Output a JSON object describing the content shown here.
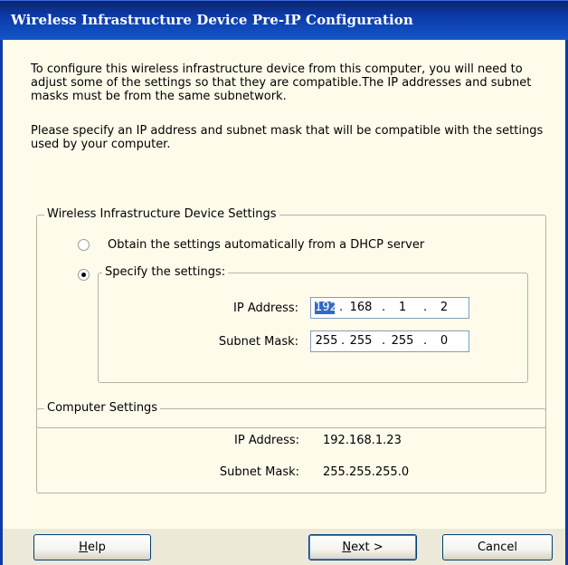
{
  "window": {
    "title": "Wireless Infrastructure Device Pre-IP Configuration"
  },
  "intro": {
    "paragraph1": "To configure this wireless infrastructure device from this computer, you will need to adjust some of the settings so that they are compatible.The IP addresses and subnet masks must be from the same subnetwork.",
    "paragraph2": "Please specify an IP address and subnet mask that will be compatible with the settings used by your computer."
  },
  "device_settings": {
    "legend": "Wireless Infrastructure Device Settings",
    "dhcp_option": "Obtain the settings automatically from a DHCP server",
    "specify_option": "Specify the settings:",
    "selected_option": "specify",
    "ip_label": "IP Address:",
    "ip_octets": [
      "192",
      "168",
      "1",
      "2"
    ],
    "mask_label": "Subnet Mask:",
    "mask_octets": [
      "255",
      "255",
      "255",
      "0"
    ]
  },
  "computer_settings": {
    "legend": "Computer Settings",
    "ip_label": "IP Address:",
    "ip_value": "192.168.1.23",
    "mask_label": "Subnet Mask:",
    "mask_value": "255.255.255.0"
  },
  "buttons": {
    "help_accel": "H",
    "help_rest": "elp",
    "next_accel": "N",
    "next_rest": "ext >",
    "cancel": "Cancel"
  },
  "colors": {
    "titlebar": "#0d3aa8",
    "panel": "#fffbeb",
    "selection": "#316ac5"
  }
}
